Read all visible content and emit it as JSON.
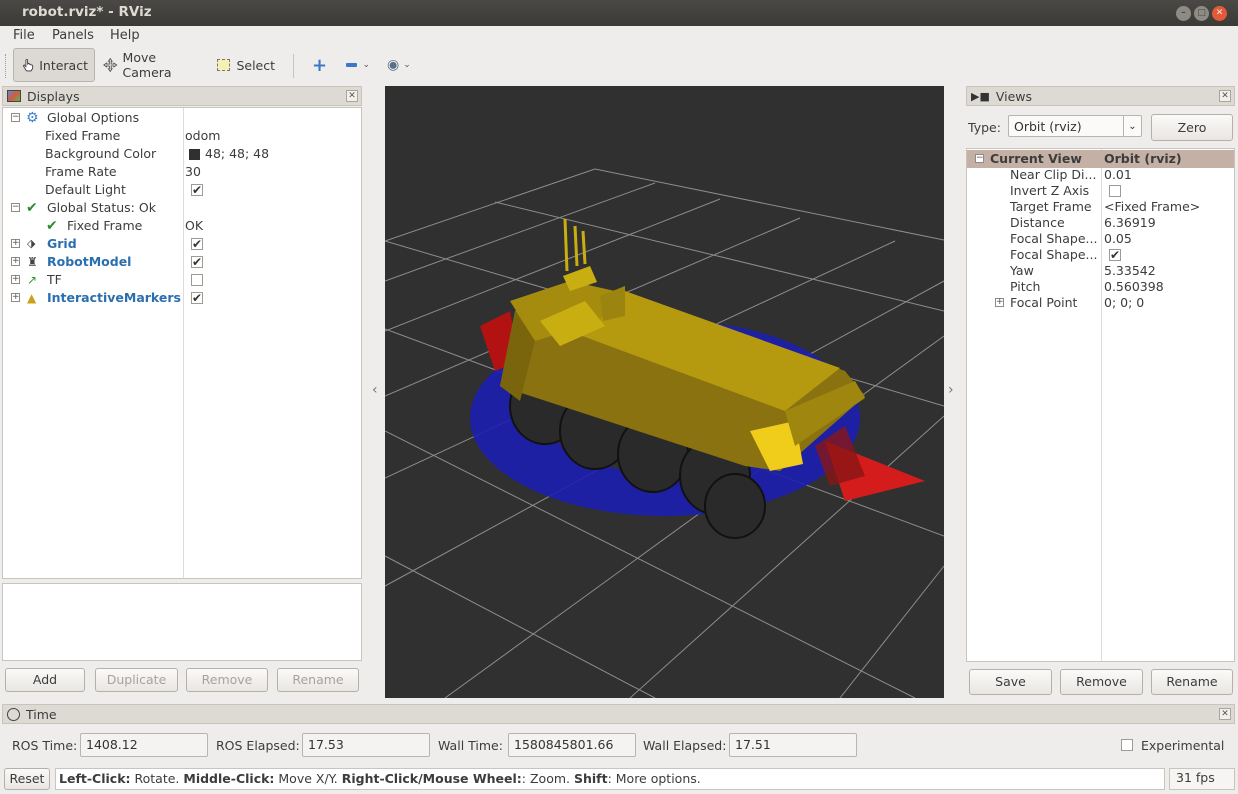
{
  "window": {
    "title": "robot.rviz* - RViz"
  },
  "menu": [
    "File",
    "Panels",
    "Help"
  ],
  "toolbar": {
    "interact": "Interact",
    "move_camera": "Move Camera",
    "select": "Select"
  },
  "displays": {
    "title": "Displays",
    "global_options": "Global Options",
    "props": [
      {
        "name": "Fixed Frame",
        "value": "odom"
      },
      {
        "name": "Background Color",
        "value": "48; 48; 48"
      },
      {
        "name": "Frame Rate",
        "value": "30"
      },
      {
        "name": "Default Light",
        "value": ""
      }
    ],
    "background_color_hex": "#303030",
    "global_status": "Global Status: Ok",
    "status_fixed_frame": "Fixed Frame",
    "status_fixed_frame_value": "OK",
    "items": [
      {
        "name": "Grid",
        "checked": true
      },
      {
        "name": "RobotModel",
        "checked": true
      },
      {
        "name": "TF",
        "checked": false
      },
      {
        "name": "InteractiveMarkers",
        "checked": true
      }
    ],
    "buttons": {
      "add": "Add",
      "duplicate": "Duplicate",
      "remove": "Remove",
      "rename": "Rename"
    }
  },
  "views": {
    "title": "Views",
    "type_label": "Type:",
    "type_value": "Orbit (rviz)",
    "zero": "Zero",
    "current_view": "Current View",
    "current_view_value": "Orbit (rviz)",
    "props": [
      {
        "name": "Near Clip Di...",
        "value": "0.01"
      },
      {
        "name": "Invert Z Axis",
        "value": ""
      },
      {
        "name": "Target Frame",
        "value": "<Fixed Frame>"
      },
      {
        "name": "Distance",
        "value": "6.36919"
      },
      {
        "name": "Focal Shape...",
        "value": "0.05"
      },
      {
        "name": "Focal Shape...",
        "value": ""
      },
      {
        "name": "Yaw",
        "value": "5.33542"
      },
      {
        "name": "Pitch",
        "value": "0.560398"
      },
      {
        "name": "Focal Point",
        "value": "0; 0; 0"
      }
    ],
    "buttons": {
      "save": "Save",
      "remove": "Remove",
      "rename": "Rename"
    }
  },
  "time": {
    "title": "Time",
    "ros_time_label": "ROS Time:",
    "ros_time": "1408.12",
    "ros_elapsed_label": "ROS Elapsed:",
    "ros_elapsed": "17.53",
    "wall_time_label": "Wall Time:",
    "wall_time": "1580845801.66",
    "wall_elapsed_label": "Wall Elapsed:",
    "wall_elapsed": "17.51",
    "experimental": "Experimental"
  },
  "statusbar": {
    "reset": "Reset",
    "hint_lc": "Left-Click:",
    "hint_lc_t": " Rotate. ",
    "hint_mc": "Middle-Click:",
    "hint_mc_t": " Move X/Y. ",
    "hint_rc": "Right-Click/Mouse Wheel:",
    "hint_rc_t": ": Zoom. ",
    "hint_sh": "Shift",
    "hint_sh_t": ": More options.",
    "fps": "31 fps"
  }
}
